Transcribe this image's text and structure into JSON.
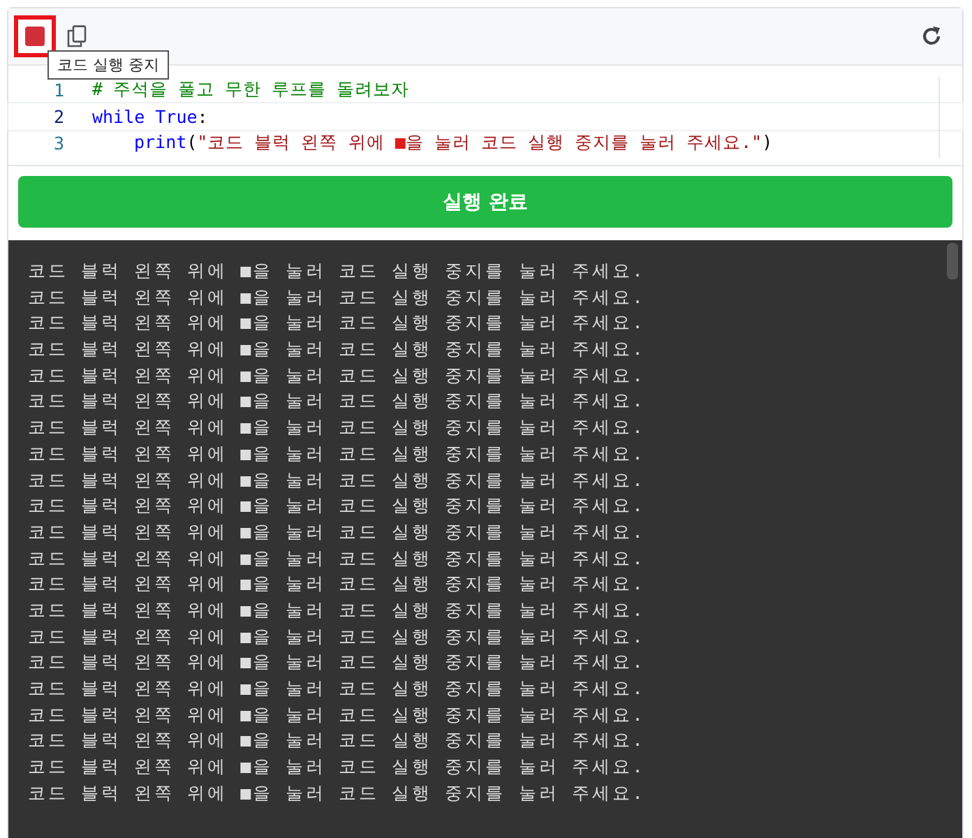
{
  "toolbar": {
    "stop_tooltip": "코드 실행 중지"
  },
  "code": [
    {
      "number": "1",
      "current": false,
      "indent": false,
      "tokens": [
        {
          "kind": "comment",
          "text": "# 주석을 풀고 무한 루프를 돌려보자"
        }
      ]
    },
    {
      "number": "2",
      "current": true,
      "indent": false,
      "tokens": [
        {
          "kind": "keyword",
          "text": "while True"
        },
        {
          "kind": "plain",
          "text": ":"
        }
      ]
    },
    {
      "number": "3",
      "current": false,
      "indent": true,
      "tokens": [
        {
          "kind": "keyword",
          "text": "print"
        },
        {
          "kind": "plain",
          "text": "("
        },
        {
          "kind": "string",
          "text": "\"코드 블럭 왼쪽 위에 "
        },
        {
          "kind": "symbol",
          "text": "■"
        },
        {
          "kind": "string",
          "text": "을 눌러 코드 실행 중지를 눌러 주세요.\""
        },
        {
          "kind": "plain",
          "text": ")"
        }
      ]
    }
  ],
  "run_button": {
    "label": "실행 완료"
  },
  "output": [
    "코드 블럭 왼쪽 위에 ■을 눌러 코드 실행 중지를 눌러 주세요.",
    "코드 블럭 왼쪽 위에 ■을 눌러 코드 실행 중지를 눌러 주세요.",
    "코드 블럭 왼쪽 위에 ■을 눌러 코드 실행 중지를 눌러 주세요.",
    "코드 블럭 왼쪽 위에 ■을 눌러 코드 실행 중지를 눌러 주세요.",
    "코드 블럭 왼쪽 위에 ■을 눌러 코드 실행 중지를 눌러 주세요.",
    "코드 블럭 왼쪽 위에 ■을 눌러 코드 실행 중지를 눌러 주세요.",
    "코드 블럭 왼쪽 위에 ■을 눌러 코드 실행 중지를 눌러 주세요.",
    "코드 블럭 왼쪽 위에 ■을 눌러 코드 실행 중지를 눌러 주세요.",
    "코드 블럭 왼쪽 위에 ■을 눌러 코드 실행 중지를 눌러 주세요.",
    "코드 블럭 왼쪽 위에 ■을 눌러 코드 실행 중지를 눌러 주세요.",
    "코드 블럭 왼쪽 위에 ■을 눌러 코드 실행 중지를 눌러 주세요.",
    "코드 블럭 왼쪽 위에 ■을 눌러 코드 실행 중지를 눌러 주세요.",
    "코드 블럭 왼쪽 위에 ■을 눌러 코드 실행 중지를 눌러 주세요.",
    "코드 블럭 왼쪽 위에 ■을 눌러 코드 실행 중지를 눌러 주세요.",
    "코드 블럭 왼쪽 위에 ■을 눌러 코드 실행 중지를 눌러 주세요.",
    "코드 블럭 왼쪽 위에 ■을 눌러 코드 실행 중지를 눌러 주세요.",
    "코드 블럭 왼쪽 위에 ■을 눌러 코드 실행 중지를 눌러 주세요.",
    "코드 블럭 왼쪽 위에 ■을 눌러 코드 실행 중지를 눌러 주세요.",
    "코드 블럭 왼쪽 위에 ■을 눌러 코드 실행 중지를 눌러 주세요.",
    "코드 블럭 왼쪽 위에 ■을 눌러 코드 실행 중지를 눌러 주세요.",
    "코드 블럭 왼쪽 위에 ■을 눌러 코드 실행 중지를 눌러 주세요."
  ]
}
